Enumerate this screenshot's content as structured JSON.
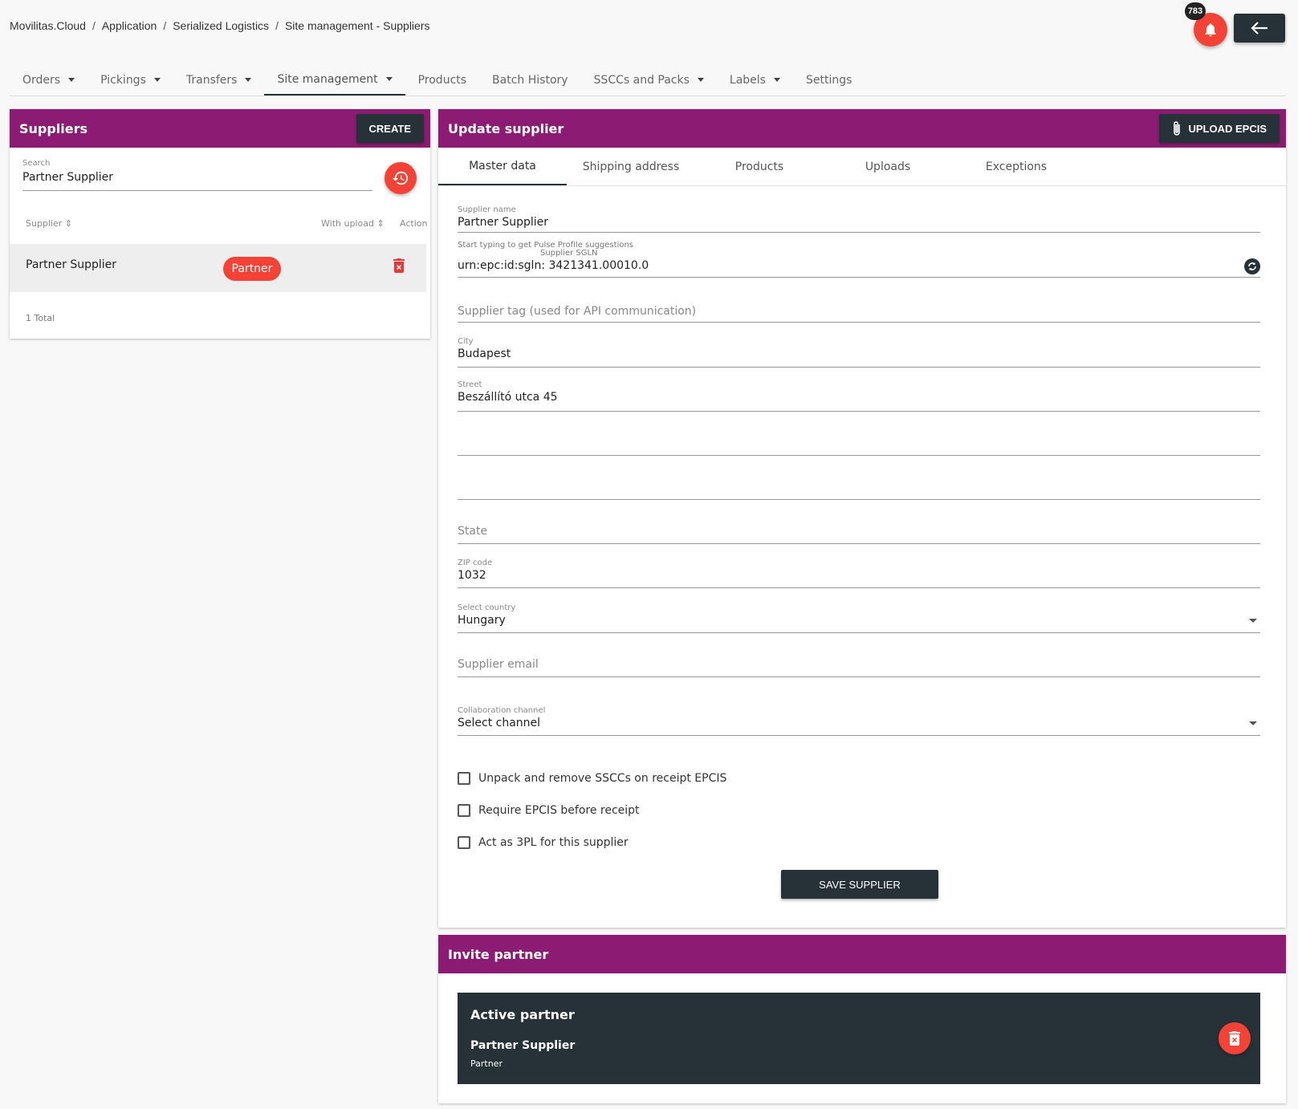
{
  "breadcrumb": [
    "Movilitas.Cloud",
    "Application",
    "Serialized Logistics",
    "Site management - Suppliers"
  ],
  "notifications": {
    "count": "783"
  },
  "nav": [
    {
      "label": "Orders",
      "dropdown": true
    },
    {
      "label": "Pickings",
      "dropdown": true
    },
    {
      "label": "Transfers",
      "dropdown": true
    },
    {
      "label": "Site management",
      "dropdown": true,
      "active": true
    },
    {
      "label": "Products",
      "dropdown": false
    },
    {
      "label": "Batch History",
      "dropdown": false
    },
    {
      "label": "SSCCs and Packs",
      "dropdown": true
    },
    {
      "label": "Labels",
      "dropdown": true
    },
    {
      "label": "Settings",
      "dropdown": false
    }
  ],
  "suppliers": {
    "title": "Suppliers",
    "create_label": "CREATE",
    "search": {
      "label": "Search",
      "value": "Partner Supplier"
    },
    "columns": {
      "supplier": "Supplier",
      "with_upload": "With upload",
      "action": "Action"
    },
    "rows": [
      {
        "name": "Partner Supplier",
        "chip": "Partner"
      }
    ],
    "total": "1 Total"
  },
  "update": {
    "title": "Update supplier",
    "upload_label": "UPLOAD EPCIS",
    "tabs": [
      "Master data",
      "Shipping address",
      "Products",
      "Uploads",
      "Exceptions"
    ],
    "supplier_name": {
      "label": "Supplier name",
      "value": "Partner Supplier",
      "hint": "Start typing to get Pulse Profile suggestions"
    },
    "sgln": {
      "label": "Supplier SGLN",
      "value": "urn:epc:id:sgln: 3421341.00010.0"
    },
    "tag": {
      "placeholder": "Supplier tag (used for API communication)"
    },
    "city": {
      "label": "City",
      "value": "Budapest"
    },
    "street": {
      "label": "Street",
      "value": "Beszállító utca 45"
    },
    "state": {
      "placeholder": "State"
    },
    "zip": {
      "label": "ZIP code",
      "value": "1032"
    },
    "country": {
      "label": "Select country",
      "value": "Hungary"
    },
    "email": {
      "placeholder": "Supplier email"
    },
    "channel": {
      "label": "Collaboration channel",
      "value": "Select channel"
    },
    "checks": [
      {
        "label": "Unpack and remove SSCCs on receipt EPCIS",
        "checked": false
      },
      {
        "label": "Require EPCIS before receipt",
        "checked": false
      },
      {
        "label": "Act as 3PL for this supplier",
        "checked": false
      }
    ],
    "save_label": "SAVE SUPPLIER"
  },
  "invite": {
    "title": "Invite partner",
    "card_title": "Active partner",
    "partner_name": "Partner Supplier",
    "partner_type": "Partner"
  },
  "colors": {
    "brand": "#8c1c73",
    "dark": "#263238",
    "accent": "#f44336"
  }
}
